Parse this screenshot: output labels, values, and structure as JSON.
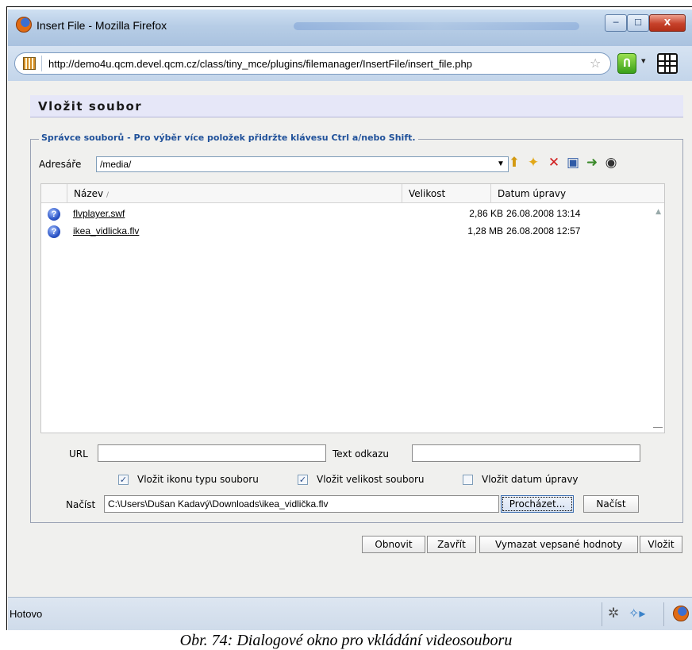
{
  "window": {
    "title": "Insert File - Mozilla Firefox",
    "url": "http://demo4u.qcm.devel.qcm.cz/class/tiny_mce/plugins/filemanager/InsertFile/insert_file.php",
    "status": "Hotovo",
    "min_glyph": "─",
    "max_glyph": "☐",
    "close_glyph": "X"
  },
  "dialog": {
    "title": "Vložit soubor",
    "legend": "Správce souborů - Pro výběr více položek přidržte klávesu Ctrl a/nebo Shift.",
    "dir_label": "Adresáře",
    "dir_value": "/media/",
    "toolbar_icons": [
      "folder-up-icon",
      "new-folder-icon",
      "delete-icon",
      "rename-icon",
      "copy-icon",
      "preview-icon"
    ],
    "columns": {
      "name": "Název",
      "sort_mark": "/",
      "size": "Velikost",
      "date": "Datum úpravy"
    },
    "files": [
      {
        "name": "flvplayer.swf",
        "size": "2,86 KB",
        "date": "26.08.2008 13:14"
      },
      {
        "name": "ikea_vidlicka.flv",
        "size": "1,28 MB",
        "date": "26.08.2008 12:57"
      }
    ],
    "url_label": "URL",
    "url_value": "",
    "link_text_label": "Text odkazu",
    "link_text_value": "",
    "checkboxes": [
      {
        "label": "Vložit ikonu typu souboru",
        "checked": true
      },
      {
        "label": "Vložit velikost souboru",
        "checked": true
      },
      {
        "label": "Vložit datum úpravy",
        "checked": false
      }
    ],
    "upload_label": "Načíst",
    "upload_path": "C:\\Users\\Dušan Kadavý\\Downloads\\ikea_vidlička.flv",
    "browse_label": "Procházet...",
    "upload_button": "Načíst",
    "buttons": {
      "refresh": "Obnovit",
      "close": "Zavřít",
      "clear": "Vymazat vepsané hodnoty",
      "insert": "Vložit"
    }
  },
  "caption": "Obr. 74: Dialogové okno pro vkládání videosouboru"
}
